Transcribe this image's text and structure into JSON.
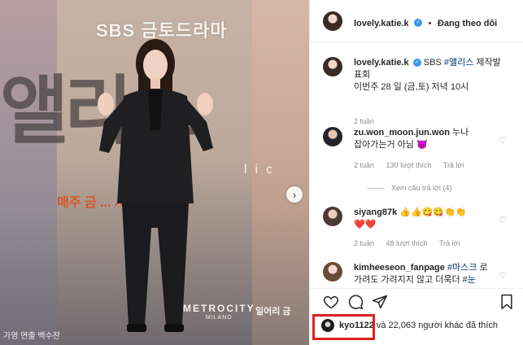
{
  "media": {
    "network_logo": "SBS 금토드라마",
    "show_title": "앨리스",
    "show_subtitle_fragment": "lic",
    "orange_line": "매주 금 ... 시 방송",
    "credits": "가영  연출 백수찬",
    "sponsor_brand": "METROCITY",
    "sponsor_city": "MILANO",
    "sponsor2": "일어리 금",
    "next_icon": "chevron-right-icon"
  },
  "header": {
    "username": "lovely.katie.k",
    "separator": "•",
    "follow_label": "Đang theo dõi"
  },
  "caption": {
    "username": "lovely.katie.k",
    "line1_prefix": "SBS ",
    "line1_tag": "#앨리스",
    "line1_suffix": " 제작발",
    "line2": "표회",
    "line3": "이번주 28 일 (금,토) 저녁 10시",
    "time": "2 tuần"
  },
  "comments": [
    {
      "username": "zu.won_moon.jun.won",
      "text": " 누나",
      "text2": "잡아가는거 아님",
      "emoji": "😈",
      "time": "2 tuần",
      "likes": "130 lượt thích",
      "reply": "Trả lời",
      "view_replies": "Xem câu trả lời (4)"
    },
    {
      "username": "siyang87k",
      "text": " 👍👍😋😋👏👏",
      "text2": "❤️❤️",
      "time": "2 tuần",
      "likes": "48 lượt thích",
      "reply": "Trả lời"
    },
    {
      "username": "kimheeseon_fanpage",
      "tag1": "#마스크",
      "text": " 로",
      "text2_prefix": "가려도 가려지지 않고 더욱더 ",
      "tag2": "#눈"
    }
  ],
  "likes": {
    "username": "kyo1122",
    "rest": " và 22,063 người khác đã thích"
  },
  "colors": {
    "highlight": "#e0201f",
    "verified": "#3897f0",
    "hashtag": "#00376b"
  }
}
